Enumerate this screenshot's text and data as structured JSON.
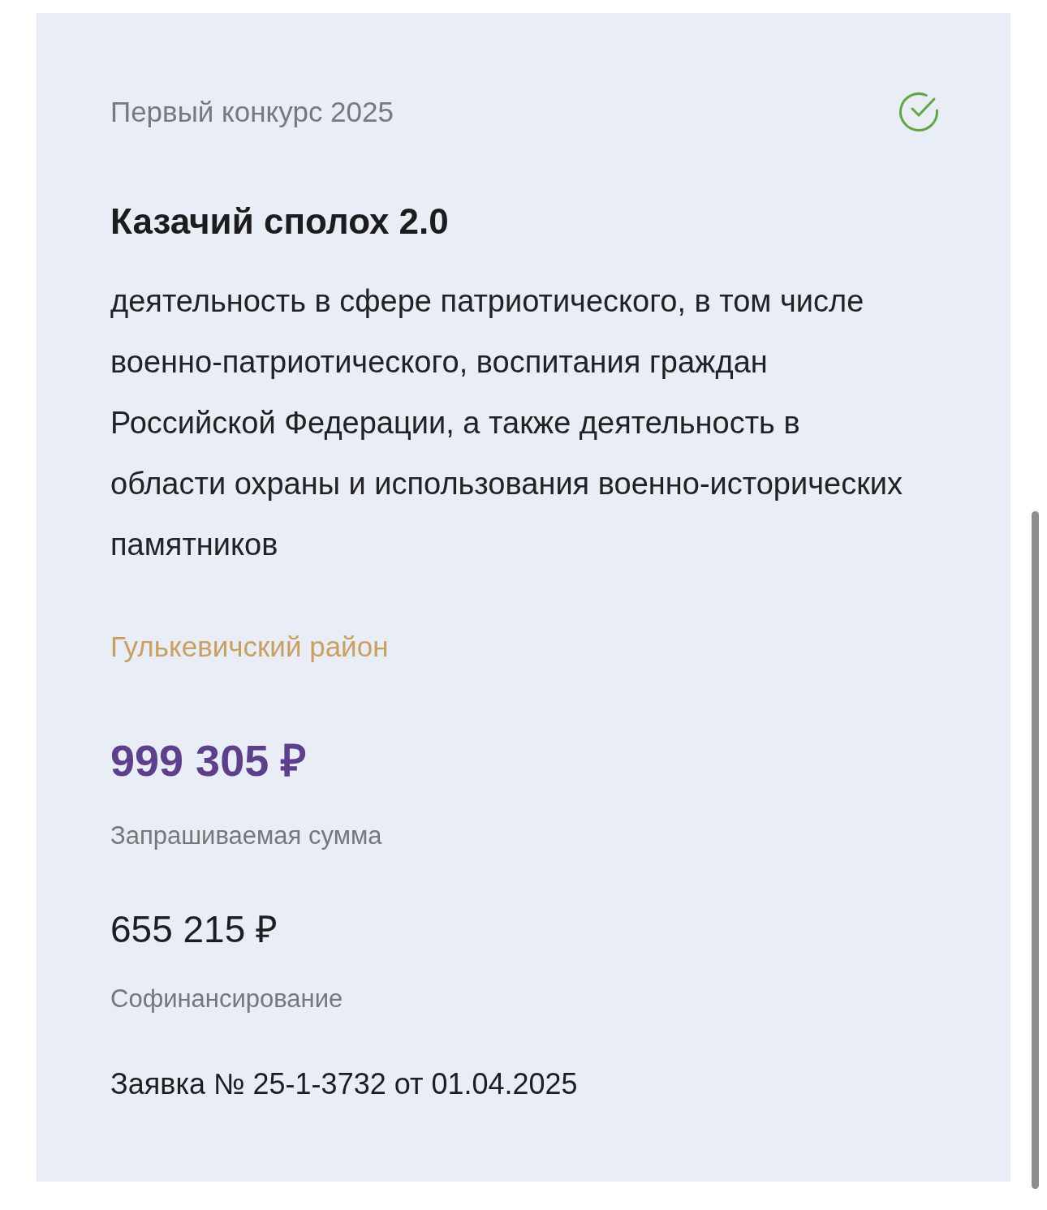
{
  "card": {
    "contest": "Первый конкурс 2025",
    "approved": true,
    "title": "Казачий сполох 2.0",
    "description": "деятельность в сфере патриотического, в том числе военно-патриотического, воспитания граждан Российской Федерации, а также деятельность в области охраны и использования военно-исторических памятников",
    "district": "Гулькевичский район",
    "requested_amount": "999 305 ₽",
    "requested_label": "Запрашиваемая сумма",
    "cofinancing_amount": "655 215 ₽",
    "cofinancing_label": "Софинансирование",
    "application": "Заявка № 25-1-3732 от 01.04.2025"
  }
}
